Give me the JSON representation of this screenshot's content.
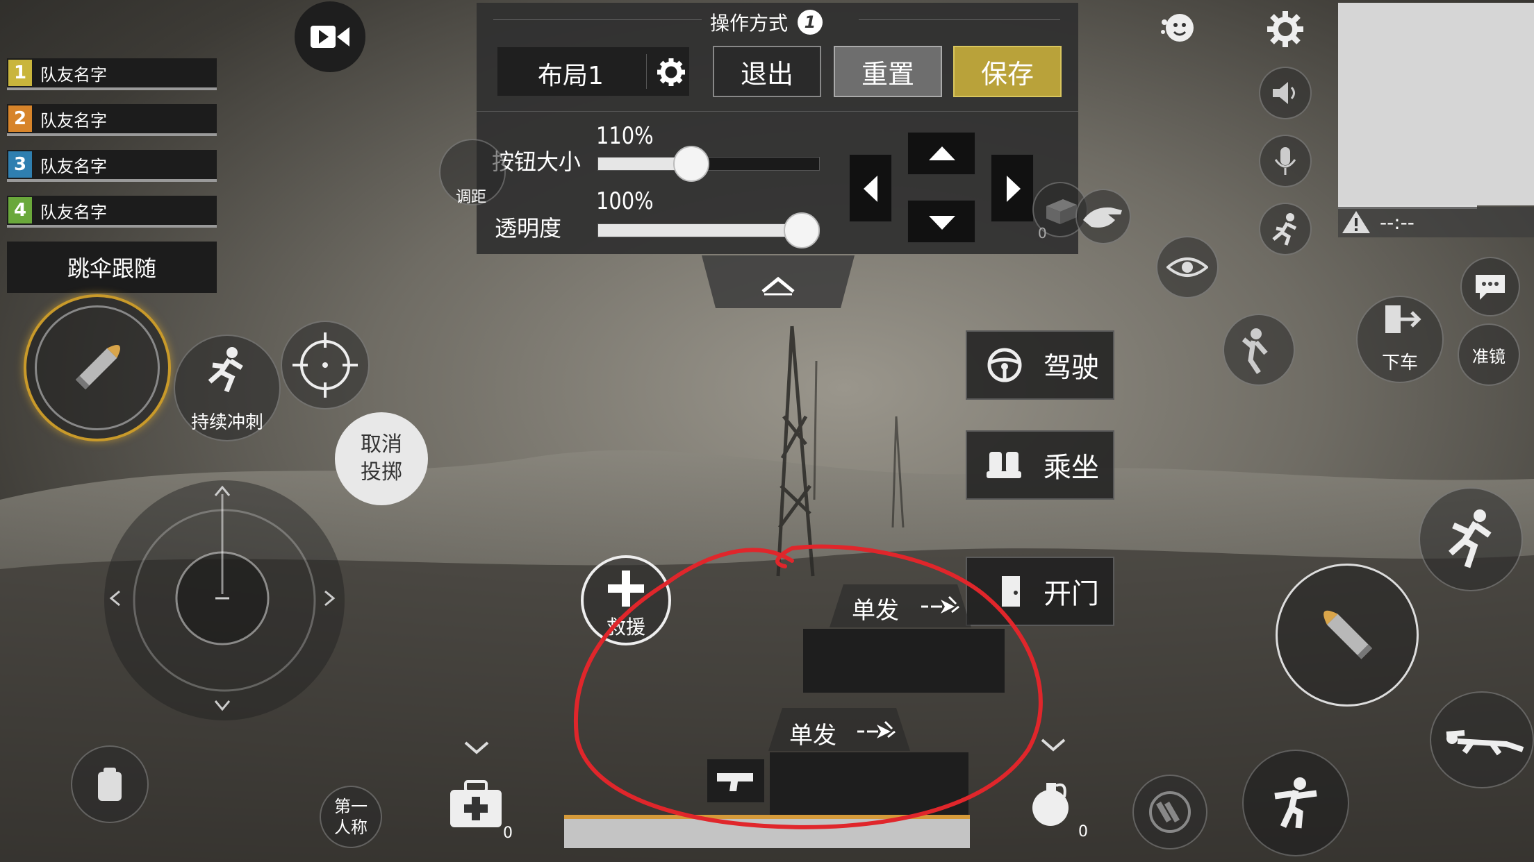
{
  "team": [
    {
      "num": "1",
      "name": "队友名字",
      "color": "#c9b53c"
    },
    {
      "num": "2",
      "name": "队友名字",
      "color": "#d7842a"
    },
    {
      "num": "3",
      "name": "队友名字",
      "color": "#2f7fb0"
    },
    {
      "num": "4",
      "name": "队友名字",
      "color": "#6aa83b"
    }
  ],
  "parachute_follow": "跳伞跟随",
  "panel": {
    "title": "操作方式",
    "info_badge": "1",
    "layout_name": "布局1",
    "exit": "退出",
    "reset": "重置",
    "save": "保存",
    "button_size_label": "按钮大小",
    "button_size_value": "110%",
    "button_size_fraction": 0.42,
    "opacity_label": "透明度",
    "opacity_value": "100%",
    "opacity_fraction": 0.92
  },
  "left_controls": {
    "sprint_label": "持续冲刺",
    "cancel_throw": "取消",
    "cancel_throw_2": "投掷",
    "distance_adjust": "调距"
  },
  "vehicle": {
    "drive": "驾驶",
    "ride": "乘坐",
    "open_door": "开门",
    "get_off": "下车",
    "scope": "准镜"
  },
  "weapon": {
    "fire_mode_1": "单发",
    "fire_mode_2": "单发"
  },
  "bottom": {
    "rescue": "救援",
    "first_person_1": "第一",
    "first_person_2": "人称",
    "medkit_count": "0",
    "grenade_count": "0",
    "ammo_count": "0"
  },
  "minimap": {
    "time": "--:--"
  },
  "colors": {
    "save_gold": "#b9a23a",
    "annotation_red": "#e0262b"
  }
}
